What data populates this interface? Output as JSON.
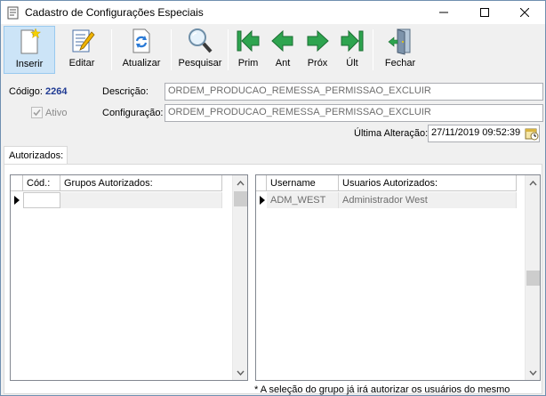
{
  "window": {
    "title": "Cadastro de Configurações Especiais"
  },
  "toolbar": {
    "inserir": "Inserir",
    "editar": "Editar",
    "atualizar": "Atualizar",
    "pesquisar": "Pesquisar",
    "prim": "Prim",
    "ant": "Ant",
    "prox": "Próx",
    "ult": "Últ",
    "fechar": "Fechar"
  },
  "form": {
    "codigo_label": "Código:",
    "codigo_value": "2264",
    "ativo_label": "Ativo",
    "ativo_checked": true,
    "descricao_label": "Descrição:",
    "descricao_value": "ORDEM_PRODUCAO_REMESSA_PERMISSAO_EXCLUIR",
    "configuracao_label": "Configuração:",
    "configuracao_value": "ORDEM_PRODUCAO_REMESSA_PERMISSAO_EXCLUIR",
    "ultima_alteracao_label": "Última Alteração:",
    "ultima_alteracao_value": "27/11/2019 09:52:39"
  },
  "tabs": [
    {
      "label": "Autorizados:",
      "active": true
    }
  ],
  "grupos_grid": {
    "columns": [
      "Cód.:",
      "Grupos Autorizados:"
    ],
    "rows": [
      {
        "cod": "",
        "grupo": ""
      }
    ]
  },
  "usuarios_grid": {
    "columns": [
      "Username",
      "Usuarios Autorizados:"
    ],
    "rows": [
      {
        "username": "ADM_WEST",
        "nome": "Administrador West"
      }
    ]
  },
  "footnote": "* A seleção do grupo já irá autorizar os usuários do mesmo",
  "colors": {
    "codigo_value": "#1f3a93",
    "arrow_green": "#2ea44f",
    "selected_button": "#cce4f7"
  }
}
